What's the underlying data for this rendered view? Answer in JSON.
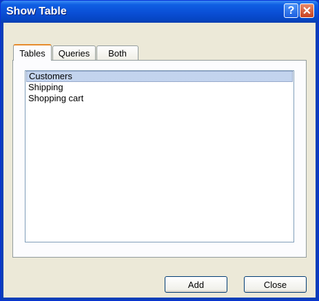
{
  "window": {
    "title": "Show Table",
    "help_glyph": "?",
    "close_glyph": "✕"
  },
  "tabs": [
    {
      "label": "Tables",
      "active": true
    },
    {
      "label": "Queries",
      "active": false
    },
    {
      "label": "Both",
      "active": false
    }
  ],
  "list": {
    "items": [
      {
        "label": "Customers",
        "selected": true
      },
      {
        "label": "Shipping",
        "selected": false
      },
      {
        "label": "Shopping cart",
        "selected": false
      }
    ]
  },
  "buttons": {
    "add_label": "Add",
    "close_label": "Close"
  },
  "colors": {
    "titlebar": "#0a4fd6",
    "dialog_bg": "#ece9d8",
    "selection": "#c3d4ee",
    "active_tab_accent": "#e68b2c"
  }
}
